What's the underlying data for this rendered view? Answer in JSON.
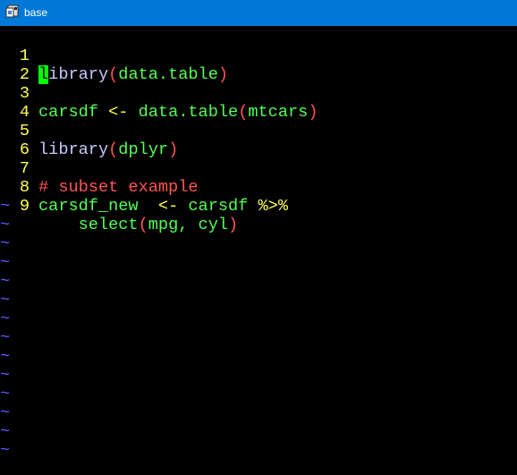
{
  "window": {
    "title": "base",
    "icon": "vim-icon",
    "colors": {
      "titlebar": "#0078d7",
      "editor_bg": "#000000"
    }
  },
  "editor": {
    "line_numbers": [
      "1",
      "2",
      "3",
      "4",
      "5",
      "6",
      "7",
      "8",
      "9"
    ],
    "lines": [
      {
        "t1": "l",
        "t2": "ibrary",
        "t3": "(",
        "t4": "data.table",
        "t5": ")"
      },
      {},
      {
        "t1": "carsdf ",
        "t2": "<-",
        "t3": " data.table",
        "t4": "(",
        "t5": "mtcars",
        "t6": ")"
      },
      {},
      {
        "t1": "library",
        "t2": "(",
        "t3": "dplyr",
        "t4": ")"
      },
      {},
      {
        "t1": "# subset example"
      },
      {
        "t1": "carsdf_new  ",
        "t2": "<-",
        "t3": " carsdf ",
        "t4": "%>%"
      },
      {
        "t1": "    select",
        "t2": "(",
        "t3": "mpg, cyl",
        "t4": ")"
      }
    ],
    "tilde_char": "~"
  }
}
